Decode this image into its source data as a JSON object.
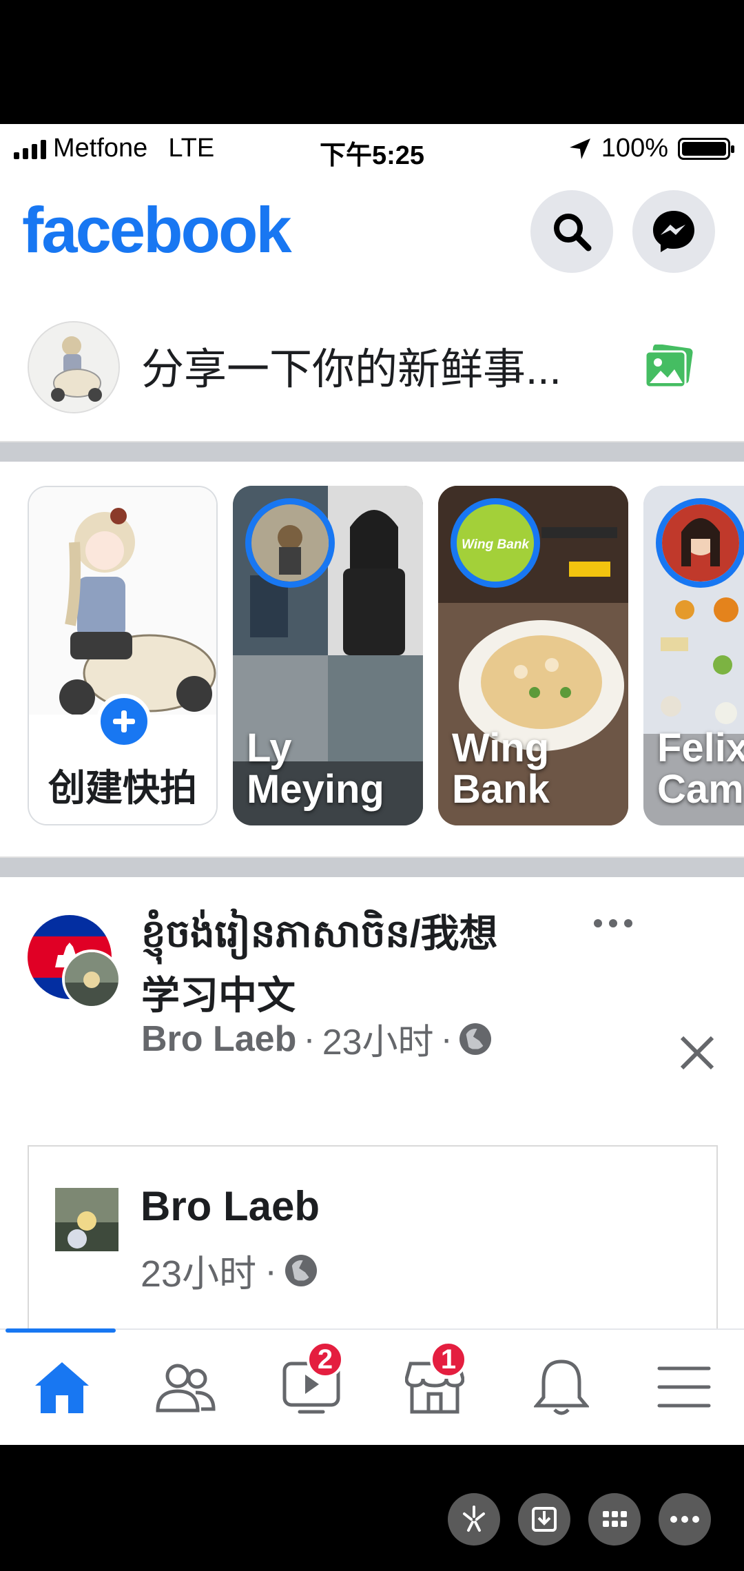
{
  "status_bar": {
    "carrier": "Metfone",
    "network": "LTE",
    "time": "下午5:25",
    "battery_percent_label": "100%",
    "battery_level": 1.0
  },
  "header": {
    "logo": "facebook",
    "search_icon": "search-icon",
    "messenger_icon": "messenger-icon"
  },
  "composer": {
    "placeholder": "分享一下你的新鲜事...",
    "photo_icon": "photo-icon"
  },
  "stories": [
    {
      "label": "创建快拍",
      "type": "create"
    },
    {
      "label": "Ly\nMeying"
    },
    {
      "label": "Wing\nBank",
      "avatar_text": "Wing Bank"
    },
    {
      "label": "Felix\nCam"
    }
  ],
  "post": {
    "title": "ខ្ញុំចង់រៀនភាសាចិន/我想学习中文",
    "author": "Bro Laeb",
    "time": "23小时",
    "separator": "·",
    "shared": {
      "author": "Bro Laeb",
      "time": "23小时"
    }
  },
  "tabbar": {
    "tabs": [
      {
        "name": "home",
        "badge": ""
      },
      {
        "name": "friends",
        "badge": ""
      },
      {
        "name": "watch",
        "badge": "2"
      },
      {
        "name": "marketplace",
        "badge": "1"
      },
      {
        "name": "notifications",
        "badge": ""
      },
      {
        "name": "menu",
        "badge": ""
      }
    ]
  },
  "colors": {
    "brand": "#1877f2",
    "badge": "#e41e3f",
    "text": "#1c1e21",
    "secondary": "#65676b"
  }
}
